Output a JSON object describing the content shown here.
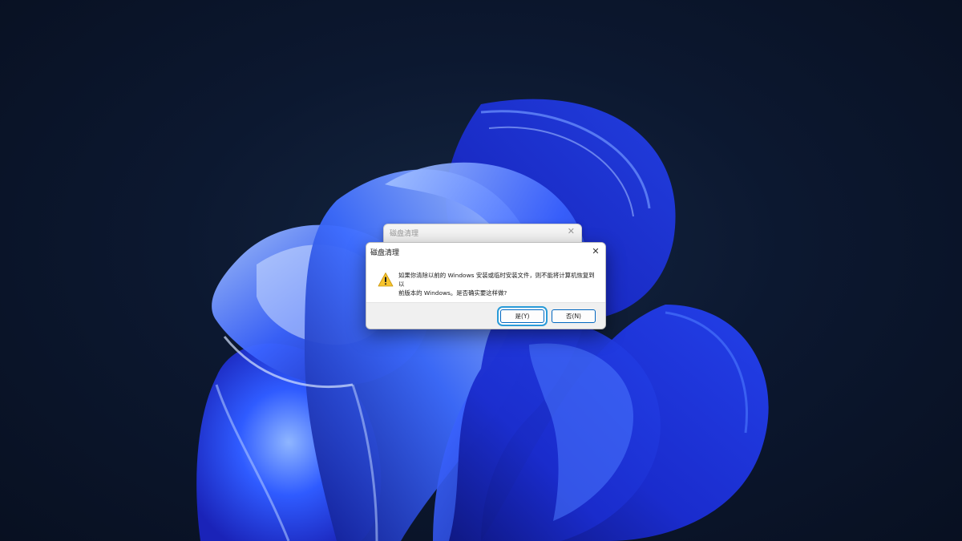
{
  "desktop": {
    "background_colors": {
      "base": "#0a1322",
      "bloom_deep": "#1c2fd6",
      "bloom_mid": "#2f5bff",
      "bloom_light": "#8fb6ff"
    }
  },
  "background_dialog": {
    "title": "磁盘清理",
    "close_glyph": "✕"
  },
  "dialog": {
    "title": "磁盘清理",
    "close_glyph": "✕",
    "icon": "warning-icon",
    "message": "如果你清除以前的 Windows 安装或临时安装文件，则不能将计算机恢复到以\n前版本的 Windows。是否确实要这样做?",
    "buttons": {
      "yes_label": "是(Y)",
      "no_label": "否(N)"
    },
    "colors": {
      "focus_ring": "#2a9bd8",
      "button_border": "#0067c0",
      "footer": "#f0f0f0"
    }
  }
}
